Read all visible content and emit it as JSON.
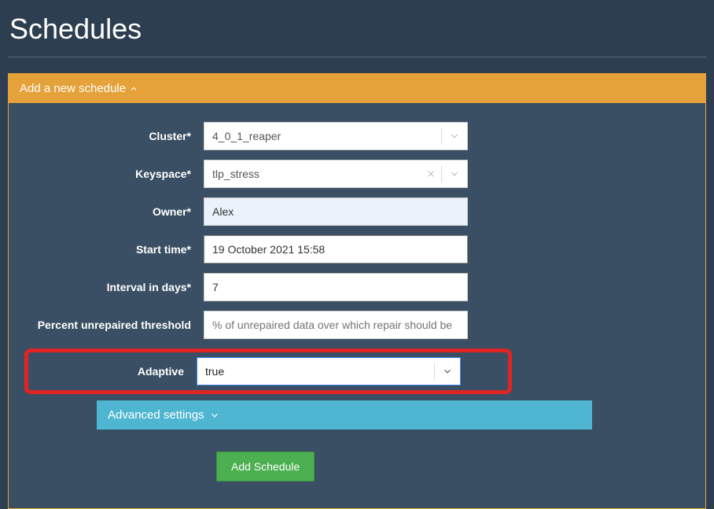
{
  "page": {
    "title": "Schedules"
  },
  "panel": {
    "header": "Add a new schedule"
  },
  "form": {
    "cluster": {
      "label": "Cluster*",
      "value": "4_0_1_reaper"
    },
    "keyspace": {
      "label": "Keyspace*",
      "value": "tlp_stress"
    },
    "owner": {
      "label": "Owner*",
      "value": "Alex"
    },
    "start": {
      "label": "Start time*",
      "value": "19 October 2021 15:58"
    },
    "interval": {
      "label": "Interval in days*",
      "value": "7"
    },
    "threshold": {
      "label": "Percent unrepaired threshold",
      "placeholder": "% of unrepaired data over which repair should be"
    },
    "adaptive": {
      "label": "Adaptive",
      "value": "true"
    }
  },
  "advanced": {
    "label": "Advanced settings"
  },
  "submit": {
    "label": "Add Schedule"
  }
}
